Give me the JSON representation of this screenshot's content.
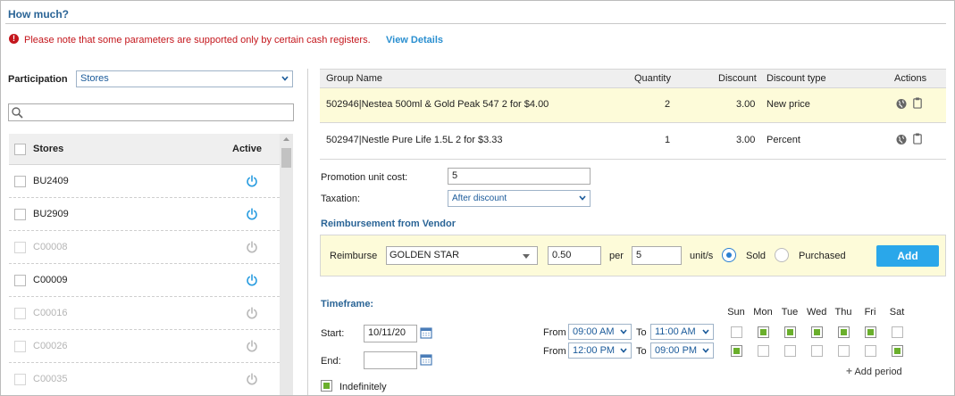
{
  "header": {
    "title": "How much?"
  },
  "warning": {
    "icon": "exclamation-icon",
    "text": "Please note that some parameters are supported only by certain cash registers.",
    "link": "View Details"
  },
  "participation": {
    "label": "Participation",
    "value": "Stores"
  },
  "search": {
    "placeholder": ""
  },
  "stores": {
    "header_name": "Stores",
    "header_active": "Active",
    "rows": [
      {
        "name": "BU2409",
        "enabled": true
      },
      {
        "name": "BU2909",
        "enabled": true
      },
      {
        "name": "C00008",
        "enabled": false
      },
      {
        "name": "C00009",
        "enabled": true
      },
      {
        "name": "C00016",
        "enabled": false
      },
      {
        "name": "C00026",
        "enabled": false
      },
      {
        "name": "C00035",
        "enabled": false
      }
    ]
  },
  "groups": {
    "columns": {
      "name": "Group Name",
      "quantity": "Quantity",
      "discount": "Discount",
      "type": "Discount type",
      "actions": "Actions"
    },
    "rows": [
      {
        "name": "502946|Nestea 500ml & Gold Peak 547 2 for $4.00",
        "quantity": "2",
        "discount": "3.00",
        "type": "New price"
      },
      {
        "name": "502947|Nestle Pure Life 1.5L 2 for $3.33",
        "quantity": "1",
        "discount": "3.00",
        "type": "Percent"
      }
    ]
  },
  "promo": {
    "unit_cost_label": "Promotion unit cost:",
    "unit_cost_value": "5",
    "taxation_label": "Taxation:",
    "taxation_value": "After discount"
  },
  "reimbursement": {
    "title": "Reimbursement from Vendor",
    "reimburse_label": "Reimburse",
    "vendor": "GOLDEN STAR",
    "amount": "0.50",
    "per_label": "per",
    "units": "5",
    "unit_label": "unit/s",
    "sold_label": "Sold",
    "purchased_label": "Purchased",
    "selected": "Sold",
    "add_label": "Add"
  },
  "timeframe": {
    "title": "Timeframe:",
    "start_label": "Start:",
    "start_value": "10/11/20",
    "end_label": "End:",
    "end_value": "",
    "indefinitely_label": "Indefinitely",
    "indefinitely_checked": true,
    "days": [
      "Sun",
      "Mon",
      "Tue",
      "Wed",
      "Thu",
      "Fri",
      "Sat"
    ],
    "periods": [
      {
        "from_label": "From",
        "from": "09:00 AM",
        "to_label": "To",
        "to": "11:00 AM",
        "days": [
          false,
          true,
          true,
          true,
          true,
          true,
          false
        ]
      },
      {
        "from_label": "From",
        "from": "12:00 PM",
        "to_label": "To",
        "to": "09:00 PM",
        "days": [
          true,
          false,
          false,
          false,
          false,
          false,
          true
        ]
      }
    ],
    "add_period_label": "Add period"
  }
}
